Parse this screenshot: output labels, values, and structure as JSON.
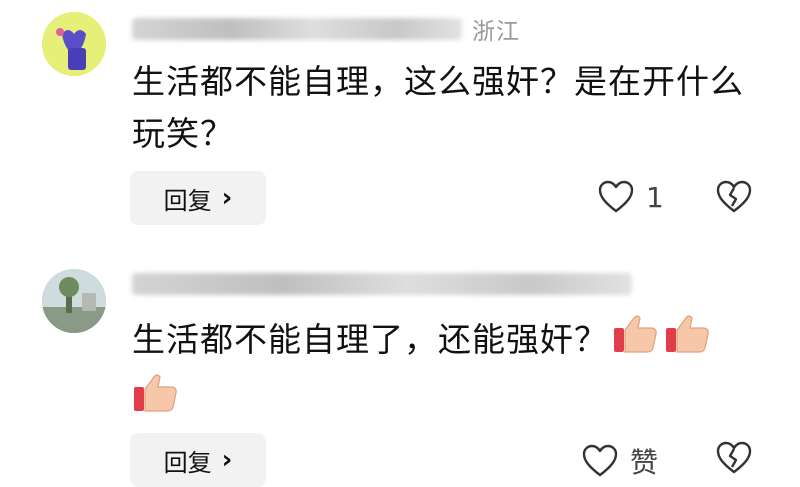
{
  "comments": [
    {
      "author_region": "浙江",
      "text": "生活都不能自理，这么强奸？是在开什么玩笑？",
      "reply_label": "回复",
      "reply_chevron": "›",
      "like_count": "1",
      "like_icon": "heart-outline-icon",
      "dislike_icon": "broken-heart-icon",
      "avatar_color": "#e6ef78"
    },
    {
      "text": "生活都不能自理了，还能强奸？",
      "emojis": [
        "thumbs-up",
        "thumbs-up",
        "thumbs-up"
      ],
      "reply_label": "回复",
      "reply_chevron": "›",
      "like_label": "赞",
      "like_icon": "heart-outline-icon",
      "dislike_icon": "broken-heart-icon",
      "avatar_color": "#c9d6d8"
    }
  ],
  "colors": {
    "text": "#111111",
    "meta_gray": "#9a9a9a",
    "reply_bg": "#f2f2f2"
  }
}
